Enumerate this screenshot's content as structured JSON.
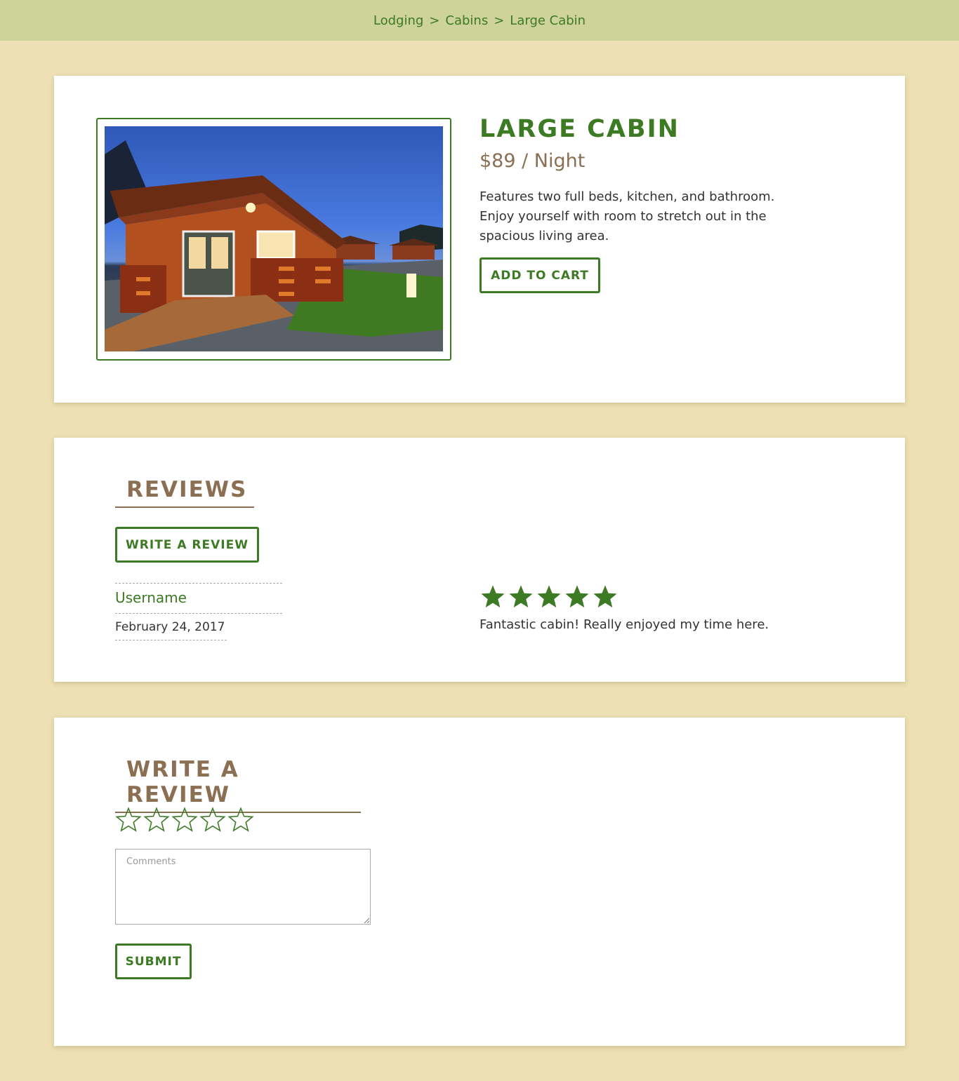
{
  "breadcrumb": {
    "item1": "Lodging",
    "sep1": ">",
    "item2": "Cabins",
    "sep2": ">",
    "item3": "Large Cabin"
  },
  "product": {
    "title": "LARGE CABIN",
    "price": "$89 / Night",
    "description": "Features two full beds, kitchen, and bathroom. Enjoy yourself with room to stretch out in the spacious living area.",
    "add_to_cart": "ADD TO CART",
    "image_icon": "cabin-photo"
  },
  "reviews": {
    "heading": "REVIEWS",
    "write_button": "WRITE A REVIEW",
    "items": [
      {
        "username": "Username",
        "date": "February 24, 2017",
        "rating": 5,
        "text": "Fantastic cabin! Really enjoyed my time here."
      }
    ]
  },
  "write_review": {
    "heading": "WRITE A REVIEW",
    "rating": 0,
    "max_rating": 5,
    "comments_placeholder": "Comments",
    "comments_value": "",
    "submit": "SUBMIT"
  },
  "colors": {
    "accent_green": "#3d7a24",
    "brown": "#8b6f52",
    "topbar": "#cdd39a",
    "background": "#ece0b4"
  }
}
